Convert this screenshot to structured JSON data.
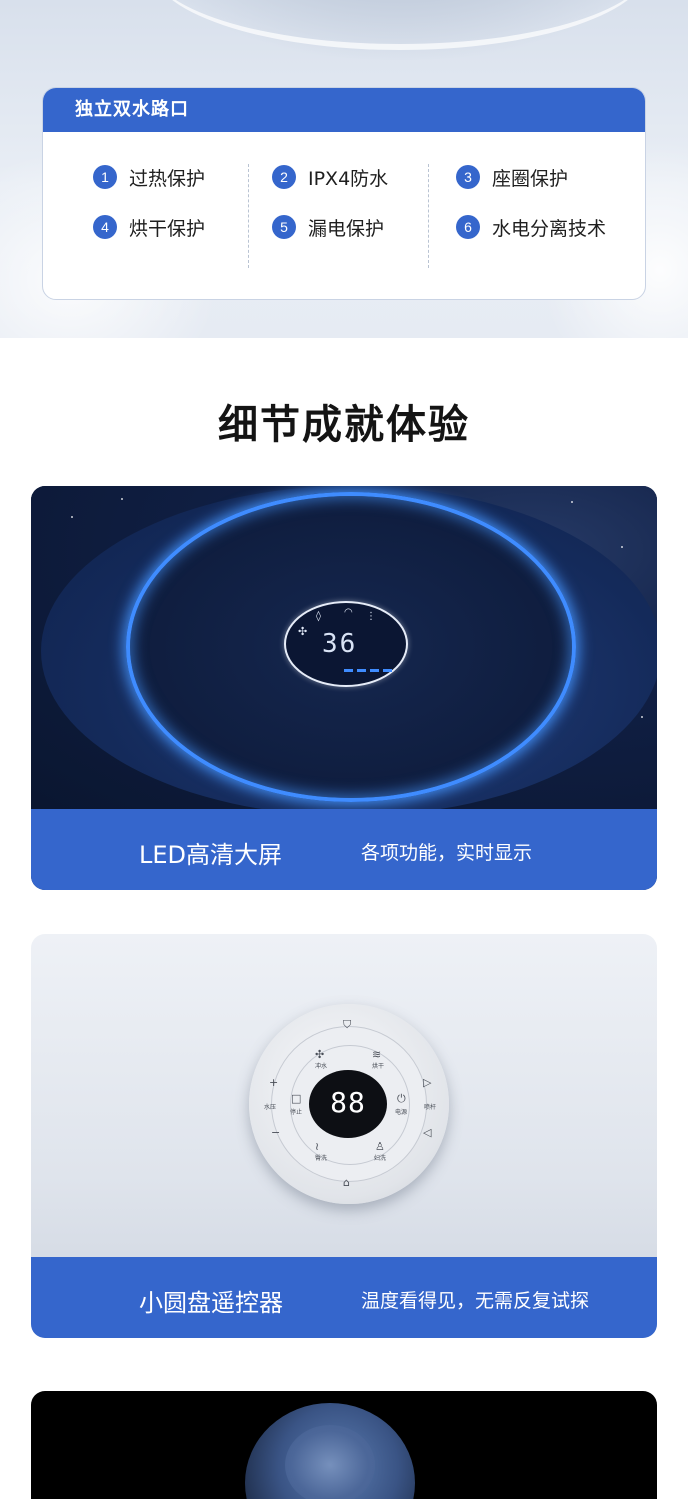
{
  "features": {
    "heading": "独立双水路口",
    "items": [
      {
        "num": "1",
        "label": "过热保护"
      },
      {
        "num": "2",
        "label": "IPX4防水"
      },
      {
        "num": "3",
        "label": "座圈保护"
      },
      {
        "num": "4",
        "label": "烘干保护"
      },
      {
        "num": "5",
        "label": "漏电保护"
      },
      {
        "num": "6",
        "label": "水电分离技术"
      }
    ]
  },
  "section": {
    "title": "细节成就体验"
  },
  "led_panel": {
    "title": "LED高清大屏",
    "desc": "各项功能，实时显示",
    "display_value": "36"
  },
  "remote_panel": {
    "title": "小圆盘遥控器",
    "desc": "温度看得见，无需反复试探",
    "display_value": "88",
    "buttons": [
      "冲水",
      "烘干",
      "停止",
      "电源",
      "臀洗",
      "妇洗",
      "水压",
      "喷杆"
    ]
  },
  "colors": {
    "accent": "#3566cc",
    "led_ring": "#3f8cff"
  }
}
